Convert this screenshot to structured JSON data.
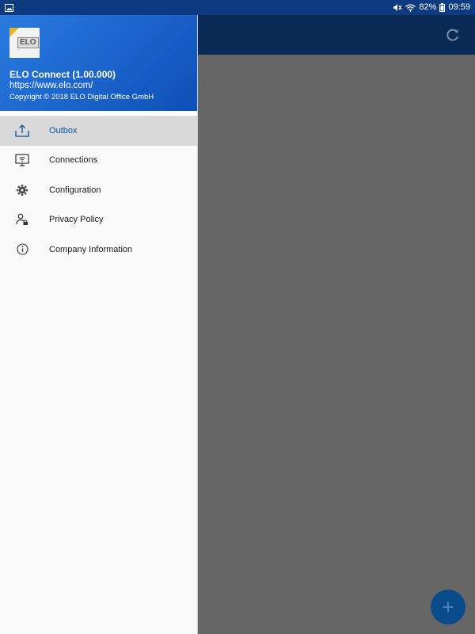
{
  "status_bar": {
    "battery": "82%",
    "time": "09:59"
  },
  "drawer": {
    "header": {
      "logo_text": "ELO",
      "app_name": "ELO Connect (1.00.000)",
      "url": "https://www.elo.com/",
      "copyright": "Copyright © 2018 ELO Digital Office GmbH"
    },
    "items": [
      {
        "label": "Outbox",
        "icon": "outbox-icon",
        "active": true
      },
      {
        "label": "Connections",
        "icon": "connections-icon",
        "active": false
      },
      {
        "label": "Configuration",
        "icon": "gear-icon",
        "active": false
      },
      {
        "label": "Privacy Policy",
        "icon": "privacy-icon",
        "active": false
      },
      {
        "label": "Company Information",
        "icon": "info-icon",
        "active": false
      }
    ]
  },
  "fab": {
    "label": "+"
  },
  "colors": {
    "accent": "#0d4fa3",
    "header_start": "#2a7be0",
    "header_end": "#0e4fb8",
    "app_bar": "#082a54",
    "scrim": "#666666"
  }
}
